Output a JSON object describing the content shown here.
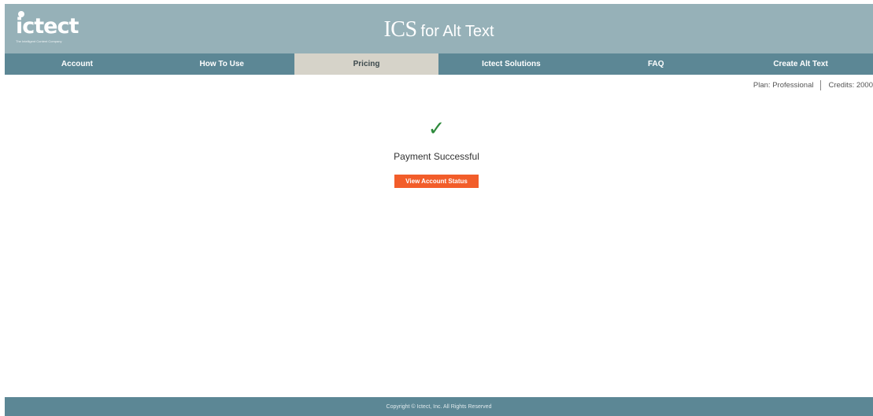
{
  "header": {
    "logo_text": "ictect",
    "logo_tagline": "The Intelligent Content Company",
    "title_main": "ICS",
    "title_rest": "for Alt Text",
    "background_color": "#96b1b8"
  },
  "nav": {
    "items": [
      {
        "label": "Account"
      },
      {
        "label": "How To Use"
      },
      {
        "label": "Pricing"
      },
      {
        "label": "Ictect Solutions"
      },
      {
        "label": "FAQ"
      },
      {
        "label": "Create Alt Text"
      }
    ],
    "active": "Pricing",
    "background_color": "#5c8795",
    "active_color": "#d6d3c9"
  },
  "account_status": {
    "plan": "Plan: Professional",
    "credits": "Credits: 2000"
  },
  "main": {
    "check_icon": "checkmark-icon",
    "message": "Payment Successful",
    "button_label": "View Account Status",
    "button_color": "#f25d2a",
    "check_color": "#2e8a3c"
  },
  "footer": {
    "copyright": "Copyright © Ictect, Inc. All Rights Reserved"
  }
}
